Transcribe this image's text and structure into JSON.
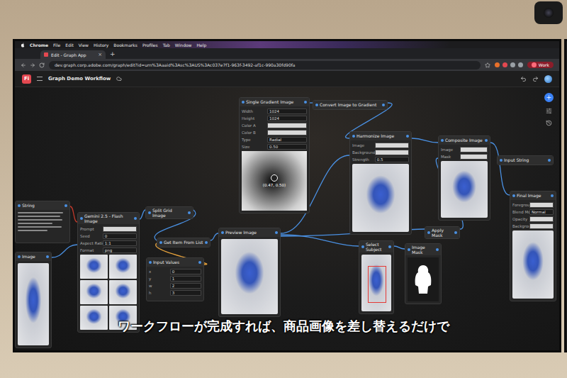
{
  "menubar": {
    "items": [
      "Chrome",
      "File",
      "Edit",
      "View",
      "History",
      "Bookmarks",
      "Profiles",
      "Tab",
      "Window",
      "Help"
    ]
  },
  "browser": {
    "tab_title": "Edit - Graph App",
    "tab_close": "×",
    "new_tab": "+",
    "url": "dev.graph.corp.adobe.com/graph/edit?id=urn%3Aaaid%3Asc%3AUS%3Ac037e7f1-963f-3492-af1c-990a30fd90fa",
    "profile": "Work"
  },
  "app": {
    "logo": "Fi",
    "title": "Graph Demo Workflow"
  },
  "nodes": [
    {
      "title": "String",
      "kind": "text",
      "fields": []
    },
    {
      "title": "Image",
      "kind": "image",
      "fields": []
    },
    {
      "title": "Gemini 2.5 - Flash Image",
      "kind": "grid",
      "thumbnails": 6,
      "fields": [
        {
          "label": "Prompt",
          "value": ""
        },
        {
          "label": "Seed",
          "value": "0"
        },
        {
          "label": "Aspect Ratio",
          "value": "1:1"
        },
        {
          "label": "Format",
          "value": "png"
        }
      ]
    },
    {
      "title": "Split Grid Image",
      "kind": "header",
      "fields": []
    },
    {
      "title": "Get Item From List",
      "kind": "header",
      "fields": []
    },
    {
      "title": "Input Values",
      "kind": "fields",
      "fields": [
        {
          "label": "x",
          "value": "0"
        },
        {
          "label": "y",
          "value": "1"
        },
        {
          "label": "w",
          "value": "2"
        },
        {
          "label": "h",
          "value": "3"
        }
      ]
    },
    {
      "title": "Preview Image",
      "kind": "image",
      "fields": []
    },
    {
      "title": "Single Gradient Image",
      "kind": "gradient",
      "caption": "(0.47, 0.50)",
      "fields": [
        {
          "label": "Width",
          "value": "1024"
        },
        {
          "label": "Height",
          "value": "1024"
        },
        {
          "label": "Color A",
          "value": ""
        },
        {
          "label": "Color B",
          "value": ""
        },
        {
          "label": "Type",
          "value": "Radial"
        },
        {
          "label": "Size",
          "value": "0.50"
        }
      ]
    },
    {
      "title": "Convert Image to Gradient",
      "kind": "header",
      "fields": []
    },
    {
      "title": "Harmonize Image",
      "kind": "image",
      "fields": [
        {
          "label": "Image",
          "value": ""
        },
        {
          "label": "Background",
          "value": ""
        },
        {
          "label": "Strength",
          "value": "0.5"
        }
      ]
    },
    {
      "title": "Composite Image",
      "kind": "image",
      "fields": [
        {
          "label": "Image",
          "value": ""
        },
        {
          "label": "Mask",
          "value": ""
        }
      ]
    },
    {
      "title": "Input String",
      "kind": "header",
      "fields": []
    },
    {
      "title": "Final Image",
      "kind": "image",
      "fields": [
        {
          "label": "Foreground",
          "value": ""
        },
        {
          "label": "Blend Mode",
          "value": "Normal"
        },
        {
          "label": "Opacity",
          "value": ""
        },
        {
          "label": "Background",
          "value": ""
        }
      ]
    },
    {
      "title": "Select Subject",
      "kind": "select",
      "fields": []
    },
    {
      "title": "Image Mask",
      "kind": "mask",
      "fields": []
    },
    {
      "title": "Apply Mask",
      "kind": "header",
      "fields": []
    }
  ],
  "subtitle": "ワークフローが完成すれば、商品画像を差し替えるだけで"
}
